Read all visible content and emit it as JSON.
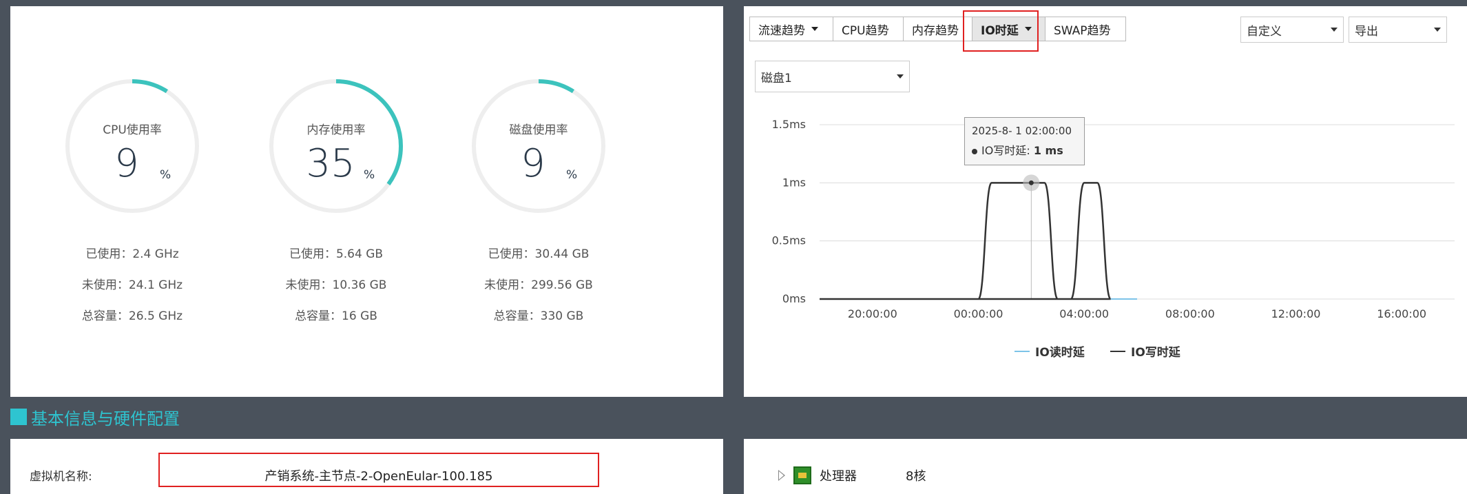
{
  "usage": {
    "gauges": [
      {
        "title": "CPU使用率",
        "value": "9",
        "unit": "%",
        "percent": 9,
        "used": "已使用：2.4 GHz",
        "free": "未使用：24.1 GHz",
        "total": "总容量：26.5 GHz"
      },
      {
        "title": "内存使用率",
        "value": "35",
        "unit": "%",
        "percent": 35,
        "used": "已使用：5.64 GB",
        "free": "未使用：10.36 GB",
        "total": "总容量：16 GB"
      },
      {
        "title": "磁盘使用率",
        "value": "9",
        "unit": "%",
        "percent": 9,
        "used": "已使用：30.44 GB",
        "free": "未使用：299.56 GB",
        "total": "总容量：330 GB"
      }
    ],
    "gauge_color": "#3cc3bd",
    "track_color": "#eeeeee"
  },
  "trend": {
    "tabs": [
      {
        "label": "流速趋势",
        "dropdown": true,
        "active": false
      },
      {
        "label": "CPU趋势",
        "dropdown": false,
        "active": false
      },
      {
        "label": "内存趋势",
        "dropdown": false,
        "active": false
      },
      {
        "label": "IO时延",
        "dropdown": true,
        "active": true
      },
      {
        "label": "SWAP趋势",
        "dropdown": false,
        "active": false
      }
    ],
    "range_select": "自定义",
    "export_select": "导出",
    "disk_select": "磁盘1",
    "tooltip": {
      "time": "2025-8- 1 02:00:00",
      "series": "IO写时延:",
      "value": "1 ms"
    },
    "legend": [
      {
        "label": "IO读时延",
        "color": "#7cc3e8"
      },
      {
        "label": "IO写时延",
        "color": "#333333"
      }
    ]
  },
  "chart_data": {
    "type": "line",
    "y_ticks": [
      "0ms",
      "0.5ms",
      "1ms",
      "1.5ms"
    ],
    "x_ticks": [
      "20:00:00",
      "00:00:00",
      "04:00:00",
      "08:00:00",
      "12:00:00",
      "16:00:00"
    ],
    "ylim": [
      0,
      1.5
    ],
    "series": [
      {
        "name": "IO读时延",
        "color": "#7cc3e8",
        "x": [
          "18:00",
          "00:00",
          "02:00",
          "04:00",
          "06:00",
          "18:00"
        ],
        "values": [
          0,
          0,
          0,
          0,
          0,
          0
        ]
      },
      {
        "name": "IO写时延",
        "color": "#333333",
        "x": [
          "18:00",
          "00:00",
          "00:30",
          "02:30",
          "03:00",
          "03:30",
          "04:00",
          "04:30",
          "05:00",
          "18:00"
        ],
        "values": [
          0,
          0,
          1,
          1,
          0,
          0,
          1,
          1,
          0,
          0
        ]
      }
    ],
    "x_hours": {
      "start": 18,
      "span": 24
    }
  },
  "section": {
    "title": "基本信息与硬件配置"
  },
  "info": {
    "vm_name_label": "虚拟机名称:",
    "vm_name_value": "产销系统-主节点-2-OpenEular-100.185"
  },
  "hardware": {
    "processor_label": "处理器",
    "processor_value": "8核"
  },
  "highlight_color": "#e02020"
}
